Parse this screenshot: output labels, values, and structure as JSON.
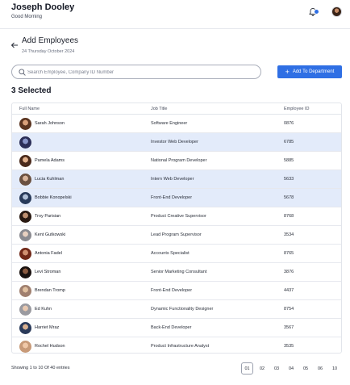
{
  "header": {
    "user_name": "Joseph Dooley",
    "greeting": "Good Morning",
    "notification_badge": "4"
  },
  "page": {
    "title": "Add Employees",
    "date": "24 Thursday October 2024"
  },
  "search": {
    "placeholder": "Search Employee, Company ID Number",
    "value": ""
  },
  "actions": {
    "add_label": "Add To Department"
  },
  "selection": {
    "label": "3 Selected"
  },
  "table": {
    "columns": [
      "Full Name",
      "Job Title",
      "Employee ID"
    ],
    "rows": [
      {
        "name": "Sarah Johnson",
        "job": "Software Engineer",
        "id": "0876",
        "selected": false
      },
      {
        "name": "",
        "job": "Investor Web Developer",
        "id": "6785",
        "selected": true
      },
      {
        "name": "Pamela Adams",
        "job": "National Program Developer",
        "id": "5885",
        "selected": false
      },
      {
        "name": "Lucia Kuhlman",
        "job": "Intern Web Developer",
        "id": "5633",
        "selected": true
      },
      {
        "name": "Bobbie Konopelski",
        "job": "Front-End Developer",
        "id": "5678",
        "selected": true
      },
      {
        "name": "Troy Parisian",
        "job": "Product Creative Supervisor",
        "id": "8768",
        "selected": false
      },
      {
        "name": "Kent Gutkowski",
        "job": "Lead Program Supervisor",
        "id": "3534",
        "selected": false
      },
      {
        "name": "Antonia Fadel",
        "job": "Accounts Specialist",
        "id": "8765",
        "selected": false
      },
      {
        "name": "Levi Stroman",
        "job": "Senior Marketing Consultant",
        "id": "3876",
        "selected": false
      },
      {
        "name": "Brendan Tromp",
        "job": "Front-End Developer",
        "id": "4437",
        "selected": false
      },
      {
        "name": "Ed Kuhn",
        "job": "Dynamic Functionality Designer",
        "id": "8754",
        "selected": false
      },
      {
        "name": "Harriet Mraz",
        "job": "Back-End Developer",
        "id": "3567",
        "selected": false
      },
      {
        "name": "Rochel Hudson",
        "job": "Product Infrastructure Analyst",
        "id": "3535",
        "selected": false
      }
    ]
  },
  "pagination": {
    "info": "Showing 1 to 10 Of 40 entries",
    "pages": [
      "01",
      "02",
      "03",
      "04",
      "05",
      "06",
      "10"
    ],
    "active": "01"
  },
  "colors": {
    "accent": "#2f6fe4",
    "selected_row": "#e3ebfa"
  }
}
